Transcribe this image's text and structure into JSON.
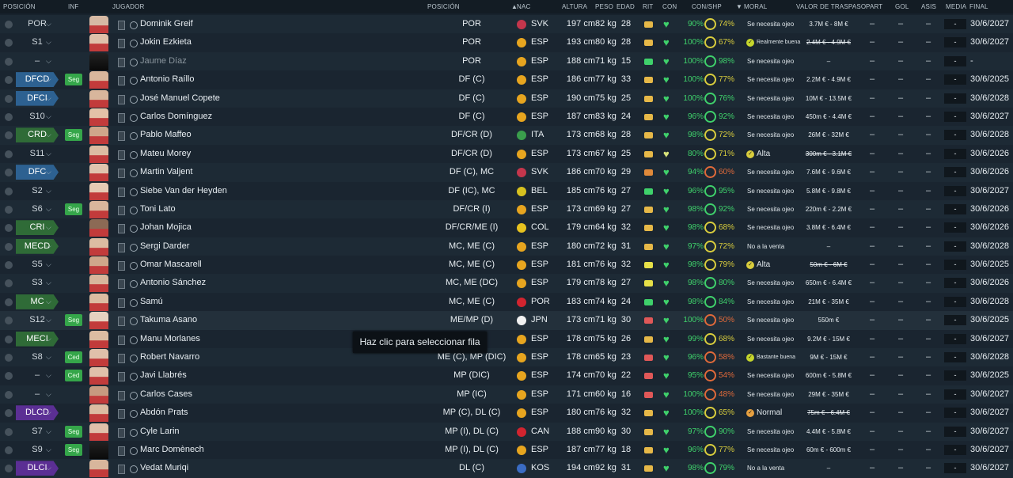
{
  "header": {
    "posicion": "POSICIÓN",
    "inf": "INF",
    "jugador": "JUGADOR",
    "posicion2": "POSICIÓN",
    "nac": "NAC",
    "altura": "ALTURA",
    "peso": "PESO",
    "edad": "EDAD",
    "rit": "RIT",
    "con": "CON",
    "conshp": "CON/SHP",
    "moral": "MORAL",
    "valor": "VALOR DE TRASPASO",
    "part": "PART",
    "gol": "GOL",
    "asis": "ASIS",
    "media": "MEDIA",
    "final": "FINAL"
  },
  "tooltip": "Haz clic para seleccionar fila",
  "colors": {
    "green": "#3fd16b",
    "yellow": "#d9cd3d",
    "red": "#e06a3a",
    "tag_blue": "#2d6191",
    "tag_green": "#2f6b37",
    "tag_purple": "#5b2f94"
  },
  "players": [
    {
      "pos": "POR",
      "tag": "",
      "inf": "",
      "name": "Dominik Greif",
      "p": "POR",
      "flag": "#c4364c",
      "nac": "SVK",
      "alt": "197 cm",
      "peso": "82 kg",
      "edad": "28",
      "rit": "#e6b848",
      "con": "90%",
      "shp": "74%",
      "ring": "y",
      "moral": "Se necesita ojeo",
      "micon": "",
      "val": "3.7M € - 8M €",
      "strike": false,
      "media": "-",
      "fin": "30/6/2027",
      "face": "#d6b9a4",
      "dim": false
    },
    {
      "pos": "S1",
      "tag": "",
      "inf": "",
      "name": "Jokin Ezkieta",
      "p": "POR",
      "flag": "#e7a51f",
      "nac": "ESP",
      "alt": "193 cm",
      "peso": "80 kg",
      "edad": "28",
      "rit": "#e6b848",
      "con": "100%",
      "shp": "67%",
      "ring": "y",
      "moral": "Realmente buena",
      "micon": "#c6d62c",
      "val": "2.4M € - 4.9M €",
      "strike": true,
      "media": "-",
      "fin": "30/6/2027",
      "face": "#e0c0aa",
      "dim": false
    },
    {
      "pos": "–",
      "tag": "",
      "inf": "",
      "name": "Jaume Díaz",
      "p": "POR",
      "flag": "#e7a51f",
      "nac": "ESP",
      "alt": "188 cm",
      "peso": "71 kg",
      "edad": "15",
      "rit": "#3fd16b",
      "con": "100%",
      "shp": "98%",
      "ring": "",
      "moral": "Se necesita ojeo",
      "micon": "",
      "val": "–",
      "strike": false,
      "media": "-",
      "fin": "-",
      "face": "shadow",
      "dim": true
    },
    {
      "pos": "DFCD",
      "tag": "blue",
      "inf": "Seg",
      "name": "Antonio Raíllo",
      "p": "DF (C)",
      "flag": "#e7a51f",
      "nac": "ESP",
      "alt": "186 cm",
      "peso": "77 kg",
      "edad": "33",
      "rit": "#e6b848",
      "con": "100%",
      "shp": "77%",
      "ring": "y",
      "moral": "Se necesita ojeo",
      "micon": "",
      "val": "2.2M € - 4.9M €",
      "strike": false,
      "media": "-",
      "fin": "30/6/2025",
      "face": "#d8b69c",
      "dim": false
    },
    {
      "pos": "DFCI",
      "tag": "blue",
      "inf": "",
      "name": "José Manuel Copete",
      "p": "DF (C)",
      "flag": "#e7a51f",
      "nac": "ESP",
      "alt": "190 cm",
      "peso": "75 kg",
      "edad": "25",
      "rit": "#e6b848",
      "con": "100%",
      "shp": "76%",
      "ring": "",
      "moral": "Se necesita ojeo",
      "micon": "",
      "val": "10M € - 13.5M €",
      "strike": false,
      "media": "-",
      "fin": "30/6/2028",
      "face": "#d8b69c",
      "dim": false
    },
    {
      "pos": "S10",
      "tag": "",
      "inf": "",
      "name": "Carlos Domínguez",
      "p": "DF (C)",
      "flag": "#e7a51f",
      "nac": "ESP",
      "alt": "187 cm",
      "peso": "83 kg",
      "edad": "24",
      "rit": "#e6b848",
      "con": "96%",
      "shp": "92%",
      "ring": "",
      "moral": "Se necesita ojeo",
      "micon": "",
      "val": "450m € - 4.4M €",
      "strike": false,
      "media": "-",
      "fin": "30/6/2027",
      "face": "#e3c2a8",
      "dim": false
    },
    {
      "pos": "CRD",
      "tag": "green",
      "inf": "Seg",
      "name": "Pablo Maffeo",
      "p": "DF/CR (D)",
      "flag": "#3a9e4c",
      "nac": "ITA",
      "alt": "173 cm",
      "peso": "68 kg",
      "edad": "28",
      "rit": "#e6b848",
      "con": "98%",
      "shp": "72%",
      "ring": "y",
      "moral": "Se necesita ojeo",
      "micon": "",
      "val": "26M € - 32M €",
      "strike": false,
      "media": "-",
      "fin": "30/6/2028",
      "face": "#cfa68a",
      "dim": false
    },
    {
      "pos": "S11",
      "tag": "",
      "inf": "",
      "name": "Mateu Morey",
      "p": "DF/CR (D)",
      "flag": "#e7a51f",
      "nac": "ESP",
      "alt": "173 cm",
      "peso": "67 kg",
      "edad": "25",
      "rit": "#e6b848",
      "con": "80%",
      "shp": "71%",
      "ring": "y",
      "moral": "Alta",
      "micon": "#d9cd3d",
      "val": "300m € - 3.1M €",
      "strike": true,
      "media": "-",
      "fin": "30/6/2026",
      "face": "#dcbca2",
      "dim": false,
      "conpale": true
    },
    {
      "pos": "DFC",
      "tag": "blue",
      "inf": "",
      "name": "Martin Valjent",
      "p": "DF (C), MC",
      "flag": "#c4364c",
      "nac": "SVK",
      "alt": "186 cm",
      "peso": "70 kg",
      "edad": "29",
      "rit": "#e08a3a",
      "con": "94%",
      "shp": "60%",
      "ring": "r",
      "moral": "Se necesita ojeo",
      "micon": "",
      "val": "7.6M € - 9.6M €",
      "strike": false,
      "media": "-",
      "fin": "30/6/2026",
      "face": "#e0c4ae",
      "dim": false
    },
    {
      "pos": "S2",
      "tag": "",
      "inf": "",
      "name": "Siebe Van der Heyden",
      "p": "DF (IC), MC",
      "flag": "#d7c11f",
      "nac": "BEL",
      "alt": "185 cm",
      "peso": "76 kg",
      "edad": "27",
      "rit": "#3fd16b",
      "con": "96%",
      "shp": "95%",
      "ring": "",
      "moral": "Se necesita ojeo",
      "micon": "",
      "val": "5.8M € - 9.8M €",
      "strike": false,
      "media": "-",
      "fin": "30/6/2027",
      "face": "#e6cab4",
      "dim": false
    },
    {
      "pos": "S6",
      "tag": "",
      "inf": "Seg",
      "name": "Toni Lato",
      "p": "DF/CR (I)",
      "flag": "#e7a51f",
      "nac": "ESP",
      "alt": "173 cm",
      "peso": "69 kg",
      "edad": "27",
      "rit": "#e6b848",
      "con": "98%",
      "shp": "92%",
      "ring": "",
      "moral": "Se necesita ojeo",
      "micon": "",
      "val": "220m € - 2.2M €",
      "strike": false,
      "media": "-",
      "fin": "30/6/2026",
      "face": "#d8b69c",
      "dim": false
    },
    {
      "pos": "CRI",
      "tag": "green",
      "inf": "",
      "name": "Johan Mojica",
      "p": "DF/CR/ME (I)",
      "flag": "#e7c21f",
      "nac": "COL",
      "alt": "179 cm",
      "peso": "64 kg",
      "edad": "32",
      "rit": "#e6b848",
      "con": "98%",
      "shp": "68%",
      "ring": "y",
      "moral": "Se necesita ojeo",
      "micon": "",
      "val": "3.8M € - 6.4M €",
      "strike": false,
      "media": "-",
      "fin": "30/6/2026",
      "face": "#8c6a55",
      "dim": false
    },
    {
      "pos": "MECD",
      "tag": "green",
      "inf": "",
      "name": "Sergi Darder",
      "p": "MC, ME (C)",
      "flag": "#e7a51f",
      "nac": "ESP",
      "alt": "180 cm",
      "peso": "72 kg",
      "edad": "31",
      "rit": "#e6b848",
      "con": "97%",
      "shp": "72%",
      "ring": "y",
      "moral": "No a la venta",
      "micon": "",
      "val": "–",
      "strike": false,
      "media": "-",
      "fin": "30/6/2028",
      "face": "#dcbca2",
      "dim": false
    },
    {
      "pos": "S5",
      "tag": "",
      "inf": "",
      "name": "Omar Mascarell",
      "p": "MC, ME (C)",
      "flag": "#e7a51f",
      "nac": "ESP",
      "alt": "181 cm",
      "peso": "76 kg",
      "edad": "32",
      "rit": "#e6e048",
      "con": "98%",
      "shp": "79%",
      "ring": "y",
      "moral": "Alta",
      "micon": "#d9cd3d",
      "val": "50m € - 6M €",
      "strike": true,
      "media": "-",
      "fin": "30/6/2025",
      "face": "#cfa68a",
      "dim": false
    },
    {
      "pos": "S3",
      "tag": "",
      "inf": "",
      "name": "Antonio Sánchez",
      "p": "MC, ME (DC)",
      "flag": "#e7a51f",
      "nac": "ESP",
      "alt": "179 cm",
      "peso": "78 kg",
      "edad": "27",
      "rit": "#e6e048",
      "con": "98%",
      "shp": "80%",
      "ring": "",
      "moral": "Se necesita ojeo",
      "micon": "",
      "val": "650m € - 6.4M €",
      "strike": false,
      "media": "-",
      "fin": "30/6/2026",
      "face": "#d8b69c",
      "dim": false
    },
    {
      "pos": "MC",
      "tag": "green",
      "inf": "",
      "name": "Samú",
      "p": "MC, ME (C)",
      "flag": "#d2242f",
      "nac": "POR",
      "alt": "183 cm",
      "peso": "74 kg",
      "edad": "24",
      "rit": "#3fd16b",
      "con": "98%",
      "shp": "84%",
      "ring": "",
      "moral": "Se necesita ojeo",
      "micon": "",
      "val": "21M € - 35M €",
      "strike": false,
      "media": "-",
      "fin": "30/6/2028",
      "face": "#dcbca2",
      "dim": false
    },
    {
      "pos": "S12",
      "tag": "",
      "inf": "Seg",
      "name": "Takuma Asano",
      "p": "ME/MP (D)",
      "flag": "#f1f1f1",
      "nac": "JPN",
      "alt": "173 cm",
      "peso": "71 kg",
      "edad": "30",
      "rit": "#e05858",
      "con": "100%",
      "shp": "50%",
      "ring": "r",
      "moral": "Se necesita ojeo",
      "micon": "",
      "val": "550m €",
      "strike": false,
      "media": "-",
      "fin": "30/6/2025",
      "face": "#e6d2c0",
      "dim": false,
      "sel": true
    },
    {
      "pos": "MECI",
      "tag": "green",
      "inf": "",
      "name": "Manu Morlanes",
      "p": "(C)",
      "flag": "#e7a51f",
      "nac": "ESP",
      "alt": "178 cm",
      "peso": "75 kg",
      "edad": "26",
      "rit": "#e6b848",
      "con": "99%",
      "shp": "68%",
      "ring": "y",
      "moral": "Se necesita ojeo",
      "micon": "",
      "val": "9.2M € - 15M €",
      "strike": false,
      "media": "-",
      "fin": "30/6/2027",
      "face": "#dcbca2",
      "dim": false
    },
    {
      "pos": "S8",
      "tag": "",
      "inf": "Ced",
      "name": "Robert Navarro",
      "p": "ME (C), MP (DIC)",
      "flag": "#e7a51f",
      "nac": "ESP",
      "alt": "178 cm",
      "peso": "65 kg",
      "edad": "23",
      "rit": "#e05858",
      "con": "96%",
      "shp": "58%",
      "ring": "r",
      "moral": "Bastante buena",
      "micon": "#c6d62c",
      "val": "9M € - 15M €",
      "strike": false,
      "media": "-",
      "fin": "30/6/2028",
      "face": "#e0c0aa",
      "dim": false
    },
    {
      "pos": "–",
      "tag": "",
      "inf": "Ced",
      "name": "Javi Llabrés",
      "p": "MP (DIC)",
      "flag": "#e7a51f",
      "nac": "ESP",
      "alt": "174 cm",
      "peso": "70 kg",
      "edad": "22",
      "rit": "#e05858",
      "con": "95%",
      "shp": "54%",
      "ring": "r",
      "moral": "Se necesita ojeo",
      "micon": "",
      "val": "600m € - 5.8M €",
      "strike": false,
      "media": "-",
      "fin": "30/6/2025",
      "face": "#e0c0aa",
      "dim": false
    },
    {
      "pos": "–",
      "tag": "",
      "inf": "",
      "name": "Carlos Cases",
      "p": "MP (IC)",
      "flag": "#e7a51f",
      "nac": "ESP",
      "alt": "171 cm",
      "peso": "60 kg",
      "edad": "16",
      "rit": "#e05858",
      "con": "100%",
      "shp": "48%",
      "ring": "r",
      "moral": "Se necesita ojeo",
      "micon": "",
      "val": "29M € - 35M €",
      "strike": false,
      "media": "-",
      "fin": "30/6/2027",
      "face": "#c79a80",
      "dim": false
    },
    {
      "pos": "DLCD",
      "tag": "purple",
      "inf": "",
      "name": "Abdón Prats",
      "p": "MP (C), DL (C)",
      "flag": "#e7a51f",
      "nac": "ESP",
      "alt": "180 cm",
      "peso": "76 kg",
      "edad": "32",
      "rit": "#e6b848",
      "con": "100%",
      "shp": "65%",
      "ring": "y",
      "moral": "Normal",
      "micon": "#e6a040",
      "val": "75m € - 6.4M €",
      "strike": true,
      "media": "-",
      "fin": "30/6/2027",
      "face": "#dcbca2",
      "dim": false
    },
    {
      "pos": "S7",
      "tag": "",
      "inf": "Seg",
      "name": "Cyle Larin",
      "p": "MP (I), DL (C)",
      "flag": "#d2242f",
      "nac": "CAN",
      "alt": "188 cm",
      "peso": "90 kg",
      "edad": "30",
      "rit": "#e6b848",
      "con": "97%",
      "shp": "90%",
      "ring": "",
      "moral": "Se necesita ojeo",
      "micon": "",
      "val": "4.4M € - 5.8M €",
      "strike": false,
      "media": "-",
      "fin": "30/6/2027",
      "face": "#e0c0aa",
      "dim": false
    },
    {
      "pos": "S9",
      "tag": "",
      "inf": "Seg",
      "name": "Marc Domènech",
      "p": "MP (I), DL (C)",
      "flag": "#e7a51f",
      "nac": "ESP",
      "alt": "187 cm",
      "peso": "77 kg",
      "edad": "18",
      "rit": "#e6b848",
      "con": "96%",
      "shp": "77%",
      "ring": "y",
      "moral": "Se necesita ojeo",
      "micon": "",
      "val": "60m € - 600m €",
      "strike": false,
      "media": "-",
      "fin": "30/6/2027",
      "face": "shadow",
      "dim": false
    },
    {
      "pos": "DLCI",
      "tag": "purple",
      "inf": "",
      "name": "Vedat Muriqi",
      "p": "DL (C)",
      "flag": "#3a6cc4",
      "nac": "KOS",
      "alt": "194 cm",
      "peso": "92 kg",
      "edad": "31",
      "rit": "#e6b848",
      "con": "98%",
      "shp": "79%",
      "ring": "",
      "moral": "No a la venta",
      "micon": "",
      "val": "–",
      "strike": false,
      "media": "-",
      "fin": "30/6/2027",
      "face": "#d8b69c",
      "dim": false
    }
  ]
}
